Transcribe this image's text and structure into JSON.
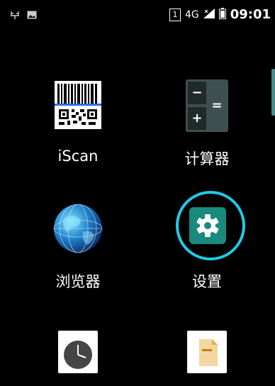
{
  "status_bar": {
    "left_icons": [
      "usb-debug-icon",
      "gallery-notification-icon"
    ],
    "sim_slot": "1",
    "network": "4G",
    "time": "09:01"
  },
  "apps": [
    {
      "name": "iScan",
      "icon": "barcode-icon"
    },
    {
      "name": "计算器",
      "icon": "calculator-icon"
    },
    {
      "name": "浏览器",
      "icon": "globe-icon"
    },
    {
      "name": "设置",
      "icon": "gear-icon"
    },
    {
      "name": "",
      "icon": "clock-icon"
    },
    {
      "name": "",
      "icon": "file-manager-icon"
    }
  ],
  "colors": {
    "highlight_ring": "#1ecbe6",
    "settings_bg": "#198a7e",
    "scroll_indicator": "#4a8c8c"
  }
}
